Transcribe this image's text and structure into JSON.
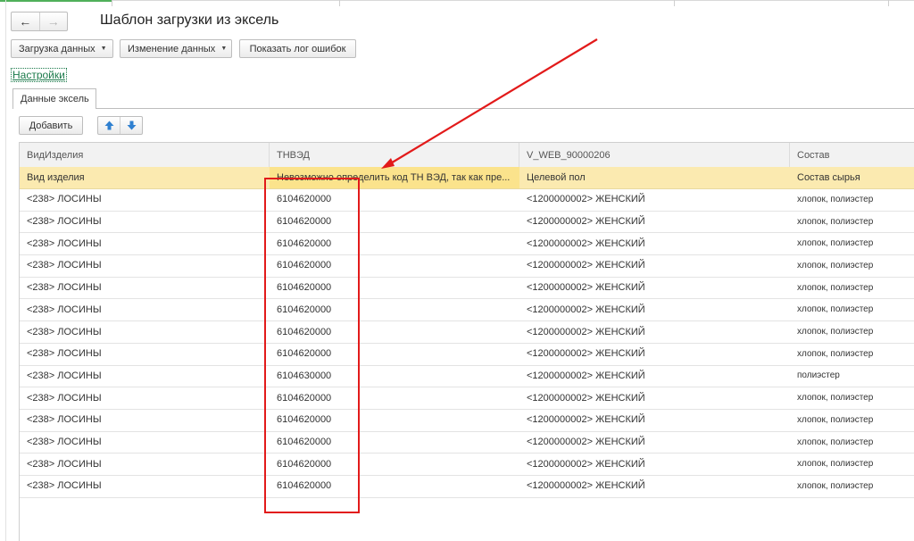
{
  "nav": {
    "back_icon": "arrow-left-icon",
    "forward_icon": "arrow-right-icon"
  },
  "title": "Шаблон загрузки из эксель",
  "toolbar": {
    "load_label": "Загрузка данных",
    "change_label": "Изменение данных",
    "log_label": "Показать лог ошибок"
  },
  "settings_link": "Настройки",
  "tab_label": "Данные эксель",
  "table_toolbar": {
    "add_label": "Добавить",
    "up_icon": "arrow-up-icon",
    "down_icon": "arrow-down-icon"
  },
  "colors": {
    "header_bg": "#f2f2f2",
    "subheader_bg": "#fbeab0",
    "annotation_red": "#e21a1a",
    "link_green": "#1b7a4a"
  },
  "table": {
    "columns": [
      "ВидИзделия",
      "ТНВЭД",
      "V_WEB_90000206",
      "Состав"
    ],
    "subheader": [
      "Вид изделия",
      "Невозможно определить код ТН ВЭД, так как пре...",
      "Целевой пол",
      "Состав сырья"
    ],
    "rows": [
      [
        "<238> ЛОСИНЫ",
        "6104620000",
        "<1200000002> ЖЕНСКИЙ",
        "хлопок, полиэстер"
      ],
      [
        "<238> ЛОСИНЫ",
        "6104620000",
        "<1200000002> ЖЕНСКИЙ",
        "хлопок, полиэстер"
      ],
      [
        "<238> ЛОСИНЫ",
        "6104620000",
        "<1200000002> ЖЕНСКИЙ",
        "хлопок, полиэстер"
      ],
      [
        "<238> ЛОСИНЫ",
        "6104620000",
        "<1200000002> ЖЕНСКИЙ",
        "хлопок, полиэстер"
      ],
      [
        "<238> ЛОСИНЫ",
        "6104620000",
        "<1200000002> ЖЕНСКИЙ",
        "хлопок, полиэстер"
      ],
      [
        "<238> ЛОСИНЫ",
        "6104620000",
        "<1200000002> ЖЕНСКИЙ",
        "хлопок, полиэстер"
      ],
      [
        "<238> ЛОСИНЫ",
        "6104620000",
        "<1200000002> ЖЕНСКИЙ",
        "хлопок, полиэстер"
      ],
      [
        "<238> ЛОСИНЫ",
        "6104620000",
        "<1200000002> ЖЕНСКИЙ",
        "хлопок, полиэстер"
      ],
      [
        "<238> ЛОСИНЫ",
        "6104630000",
        "<1200000002> ЖЕНСКИЙ",
        "полиэстер"
      ],
      [
        "<238> ЛОСИНЫ",
        "6104620000",
        "<1200000002> ЖЕНСКИЙ",
        "хлопок, полиэстер"
      ],
      [
        "<238> ЛОСИНЫ",
        "6104620000",
        "<1200000002> ЖЕНСКИЙ",
        "хлопок, полиэстер"
      ],
      [
        "<238> ЛОСИНЫ",
        "6104620000",
        "<1200000002> ЖЕНСКИЙ",
        "хлопок, полиэстер"
      ],
      [
        "<238> ЛОСИНЫ",
        "6104620000",
        "<1200000002> ЖЕНСКИЙ",
        "хлопок, полиэстер"
      ],
      [
        "<238> ЛОСИНЫ",
        "6104620000",
        "<1200000002> ЖЕНСКИЙ",
        "хлопок, полиэстер"
      ]
    ]
  }
}
